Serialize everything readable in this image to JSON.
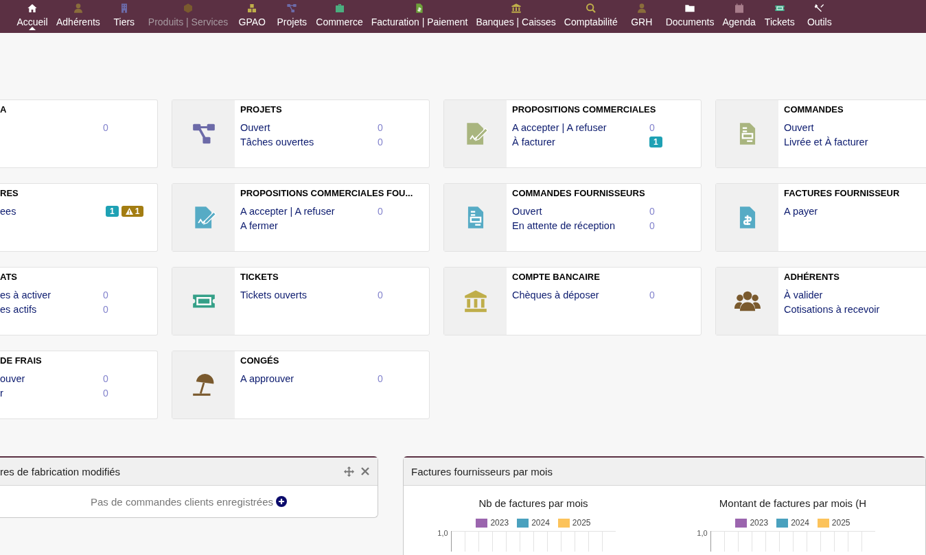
{
  "menu": [
    {
      "label": "Accueil",
      "selected": true,
      "disabled": false
    },
    {
      "label": "Adhérents",
      "selected": false,
      "disabled": false
    },
    {
      "label": "Tiers",
      "selected": false,
      "disabled": false
    },
    {
      "label": "Produits | Services",
      "selected": false,
      "disabled": true
    },
    {
      "label": "GPAO",
      "selected": false,
      "disabled": false
    },
    {
      "label": "Projets",
      "selected": false,
      "disabled": false
    },
    {
      "label": "Commerce",
      "selected": false,
      "disabled": false
    },
    {
      "label": "Facturation | Paiement",
      "selected": false,
      "disabled": false
    },
    {
      "label": "Banques | Caisses",
      "selected": false,
      "disabled": false
    },
    {
      "label": "Comptabilité",
      "selected": false,
      "disabled": false
    },
    {
      "label": "GRH",
      "selected": false,
      "disabled": false
    },
    {
      "label": "Documents",
      "selected": false,
      "disabled": false
    },
    {
      "label": "Agenda",
      "selected": false,
      "disabled": false
    },
    {
      "label": "Tickets",
      "selected": false,
      "disabled": false
    },
    {
      "label": "Outils",
      "selected": false,
      "disabled": false
    }
  ],
  "cards": [
    {
      "kind": "partial",
      "title": "A",
      "rows": [
        {
          "value": "0"
        }
      ]
    },
    {
      "kind": "full",
      "title": "PROJETS",
      "rows": [
        {
          "label": "Ouvert",
          "value": "0"
        },
        {
          "label": "Tâches ouvertes",
          "value": "0"
        }
      ]
    },
    {
      "kind": "full",
      "title": "PROPOSITIONS COMMERCIALES",
      "rows": [
        {
          "label": "A accepter | A refuser",
          "value": "0"
        },
        {
          "label": "À facturer",
          "badges": [
            {
              "kind": "info",
              "text": "1"
            }
          ]
        }
      ]
    },
    {
      "kind": "full",
      "title": "COMMANDES",
      "rows": [
        {
          "label": "Ouvert"
        },
        {
          "label": "Livrée et À facturer"
        }
      ]
    },
    {
      "kind": "partial",
      "title": "RES",
      "rows": [
        {
          "label": "ees",
          "badges": [
            {
              "kind": "info",
              "text": "1"
            },
            {
              "kind": "warning",
              "text": "1"
            }
          ]
        }
      ]
    },
    {
      "kind": "full",
      "title": "PROPOSITIONS COMMERCIALES FOU...",
      "rows": [
        {
          "label": "A accepter | A refuser",
          "value": "0"
        },
        {
          "label": "A fermer"
        }
      ]
    },
    {
      "kind": "full",
      "title": "COMMANDES FOURNISSEURS",
      "rows": [
        {
          "label": "Ouvert",
          "value": "0"
        },
        {
          "label": "En attente de réception",
          "value": "0"
        }
      ]
    },
    {
      "kind": "full",
      "title": "FACTURES FOURNISSEUR",
      "rows": [
        {
          "label": "A payer"
        }
      ]
    },
    {
      "kind": "partial",
      "title": "ATS",
      "rows": [
        {
          "label": "es à activer",
          "value": "0"
        },
        {
          "label": "es actifs",
          "value": "0"
        }
      ]
    },
    {
      "kind": "full",
      "title": "TICKETS",
      "rows": [
        {
          "label": "Tickets ouverts",
          "value": "0"
        }
      ]
    },
    {
      "kind": "full",
      "title": "COMPTE BANCAIRE",
      "rows": [
        {
          "label": "Chèques à déposer",
          "value": "0"
        }
      ]
    },
    {
      "kind": "full",
      "title": "ADHÉRENTS",
      "rows": [
        {
          "label": "À valider"
        },
        {
          "label": "Cotisations à recevoir"
        }
      ]
    },
    {
      "kind": "partial",
      "title": "DE FRAIS",
      "rows": [
        {
          "label": "ouver",
          "value": "0"
        },
        {
          "label": "r",
          "value": "0"
        }
      ]
    },
    {
      "kind": "full",
      "title": "CONGÉS",
      "rows": [
        {
          "label": "A approuver",
          "value": "0"
        }
      ]
    }
  ],
  "widgets": [
    {
      "title": "res de fabrication modifiés",
      "kind": "message",
      "message": "Pas de commandes clients enregistrées"
    },
    {
      "title": "Factures fournisseurs par mois",
      "kind": "charts",
      "charts": [
        {
          "title": "Nb de factures par mois",
          "ytick": "1,0",
          "legend": [
            {
              "label": "2023",
              "color": "#9b65ae"
            },
            {
              "label": "2024",
              "color": "#4aa1be"
            },
            {
              "label": "2025",
              "color": "#fcc35b"
            }
          ]
        },
        {
          "title": "Montant de factures par mois (H",
          "ytick": "1,0",
          "legend": [
            {
              "label": "2023",
              "color": "#9b65ae"
            },
            {
              "label": "2024",
              "color": "#4aa1be"
            },
            {
              "label": "2025",
              "color": "#fcc35b"
            }
          ]
        }
      ]
    }
  ]
}
